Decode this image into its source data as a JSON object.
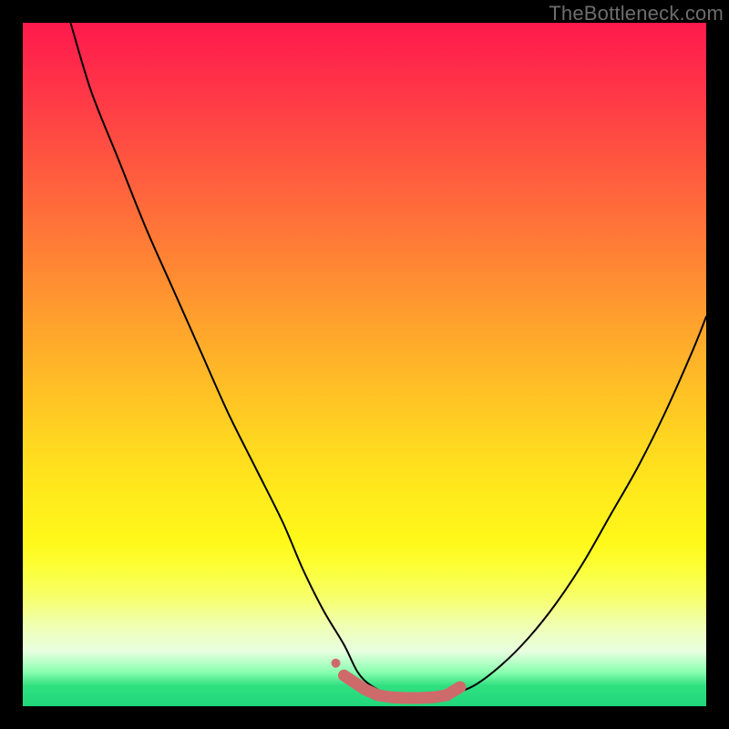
{
  "watermark": "TheBottleneck.com",
  "colors": {
    "background": "#000000",
    "curve_stroke": "#000000",
    "marker_stroke": "#cf6a6a",
    "marker_fill": "#cf6a6a"
  },
  "chart_data": {
    "type": "line",
    "title": "",
    "xlabel": "",
    "ylabel": "",
    "xlim": [
      0,
      100
    ],
    "ylim": [
      0,
      100
    ],
    "series": [
      {
        "name": "bottleneck-curve",
        "x": [
          7,
          10,
          14,
          18,
          22,
          26,
          30,
          34,
          38,
          41,
          44,
          47,
          49,
          51,
          54,
          56,
          59,
          62,
          66,
          70,
          74,
          78,
          82,
          86,
          90,
          94,
          98,
          100
        ],
        "y": [
          100,
          90,
          80,
          70,
          61,
          52,
          43,
          35,
          27,
          20,
          14,
          9,
          5,
          3,
          1.5,
          1,
          1,
          1.5,
          3,
          6,
          10,
          15,
          21,
          28,
          35,
          43,
          52,
          57
        ]
      }
    ],
    "markers": {
      "name": "fit-region",
      "x": [
        47,
        50,
        52,
        54,
        56,
        58,
        60,
        62,
        64
      ],
      "y": [
        4.5,
        2.5,
        1.6,
        1.3,
        1.2,
        1.2,
        1.3,
        1.6,
        2.8
      ]
    }
  }
}
